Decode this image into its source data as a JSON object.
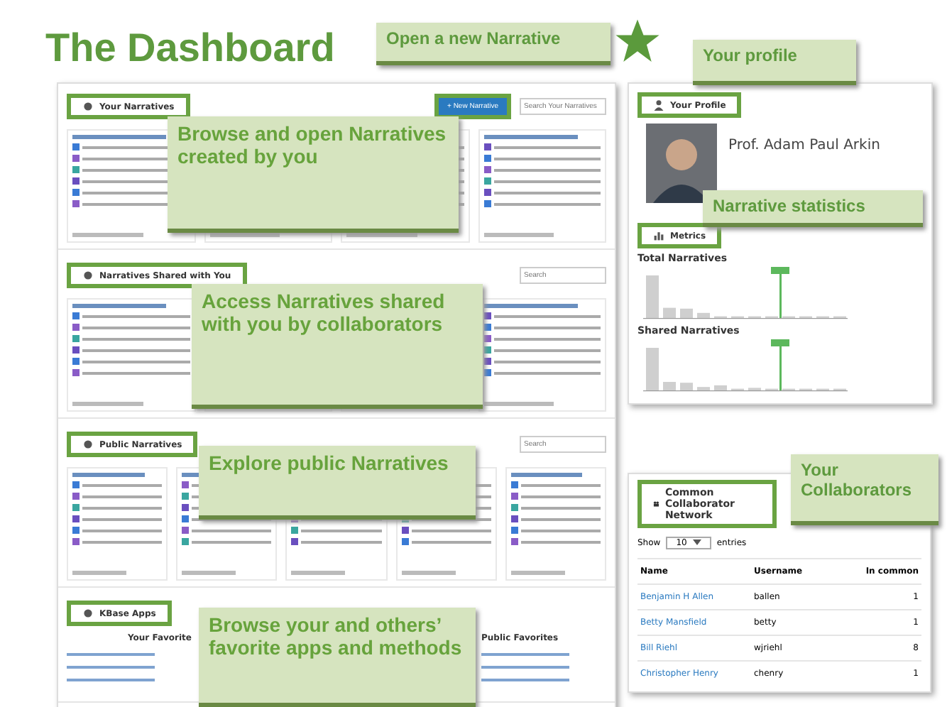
{
  "title": "The Dashboard",
  "callouts": [
    "Open a new Narrative",
    "Your profile",
    "Browse and open Narratives created by you",
    "Narrative statistics",
    "Access Narratives shared with you by collaborators",
    "Explore public Narratives",
    "Your Collaborators",
    "Browse your and others’ favorite apps and methods"
  ],
  "sections": [
    {
      "kind": "narratives",
      "title": "Your Narratives",
      "button": "+ New Narrative",
      "search_placeholder": "Search Your Narratives"
    },
    {
      "kind": "narratives",
      "title": "Narratives Shared with You",
      "search_placeholder": "Search"
    },
    {
      "kind": "narratives",
      "title": "Public Narratives",
      "search_placeholder": "Search"
    },
    {
      "kind": "apps",
      "title": "KBase Apps",
      "columns": [
        "Your Favorite",
        "Public Favorites"
      ]
    }
  ],
  "profile": {
    "header": "Your Profile",
    "name": "Prof. Adam Paul Arkin"
  },
  "metrics": {
    "header": "Metrics",
    "charts": [
      "Total Narratives",
      "Shared Narratives"
    ]
  },
  "collaborators": {
    "header": "Common Collaborator Network",
    "show": "Show",
    "page_size": "10",
    "entries": "entries",
    "columns": [
      "Name",
      "Username",
      "In common"
    ],
    "rows": [
      [
        "Benjamin H Allen",
        "ballen",
        "1"
      ],
      [
        "Betty Mansfield",
        "betty",
        "1"
      ],
      [
        "Bill Riehl",
        "wjriehl",
        "8"
      ],
      [
        "Christopher Henry",
        "chenry",
        "1"
      ]
    ]
  }
}
